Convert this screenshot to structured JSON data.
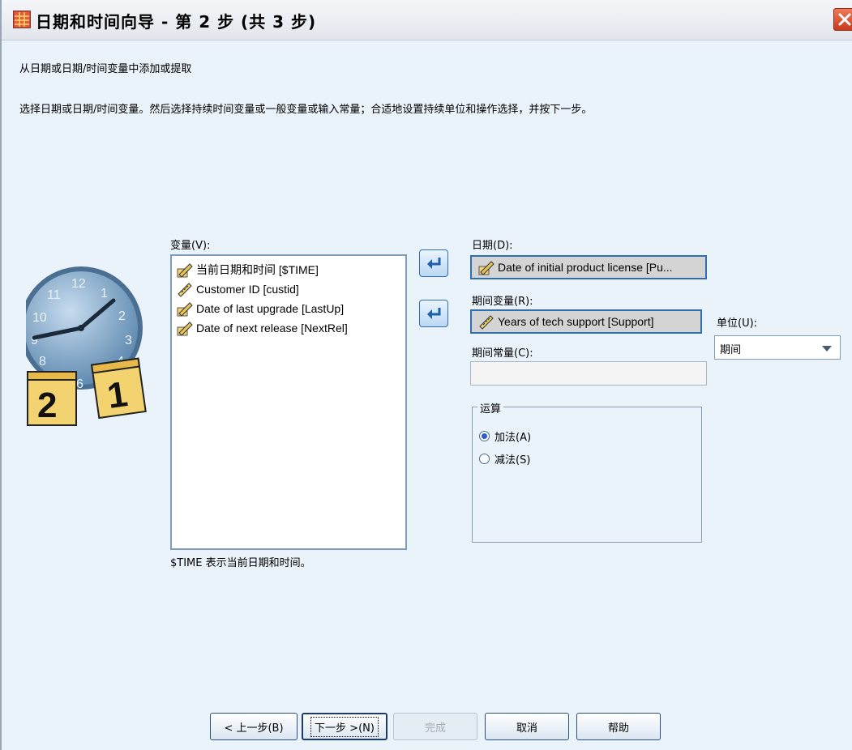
{
  "window": {
    "title": "日期和时间向导 - 第 2 步 (共 3 步)"
  },
  "instructions": {
    "heading": "从日期或日期/时间变量中添加或提取",
    "body": "选择日期或日期/时间变量。然后选择持续时间变量或一般变量或输入常量；合适地设置持续单位和操作选择，并按下一步。"
  },
  "variables": {
    "label": "变量(V):",
    "items": [
      {
        "label": "当前日期和时间 [$TIME]",
        "icon": "date-variable-icon"
      },
      {
        "label": "Customer ID [custid]",
        "icon": "scale-variable-icon"
      },
      {
        "label": "Date of last upgrade [LastUp]",
        "icon": "date-variable-icon"
      },
      {
        "label": "Date of next release [NextRel]",
        "icon": "date-variable-icon"
      }
    ],
    "footnote": "$TIME 表示当前日期和时间。"
  },
  "date_field": {
    "label": "日期(D):",
    "value": "Date of initial product license [Pu..."
  },
  "duration_variable": {
    "label": "期间变量(R):",
    "value": "Years of tech support [Support]"
  },
  "duration_constant": {
    "label": "期间常量(C):",
    "value": ""
  },
  "unit": {
    "label": "单位(U):",
    "selected": "期间"
  },
  "operation": {
    "legend": "运算",
    "options": [
      {
        "label": "加法(A)",
        "checked": true
      },
      {
        "label": "减法(S)",
        "checked": false
      }
    ]
  },
  "buttons": {
    "back": "< 上一步(B)",
    "next": "下一步 >(N)",
    "finish": "完成",
    "cancel": "取消",
    "help": "帮助"
  },
  "colors": {
    "background": "#eaf2fa",
    "accent": "#2f6fb0"
  }
}
